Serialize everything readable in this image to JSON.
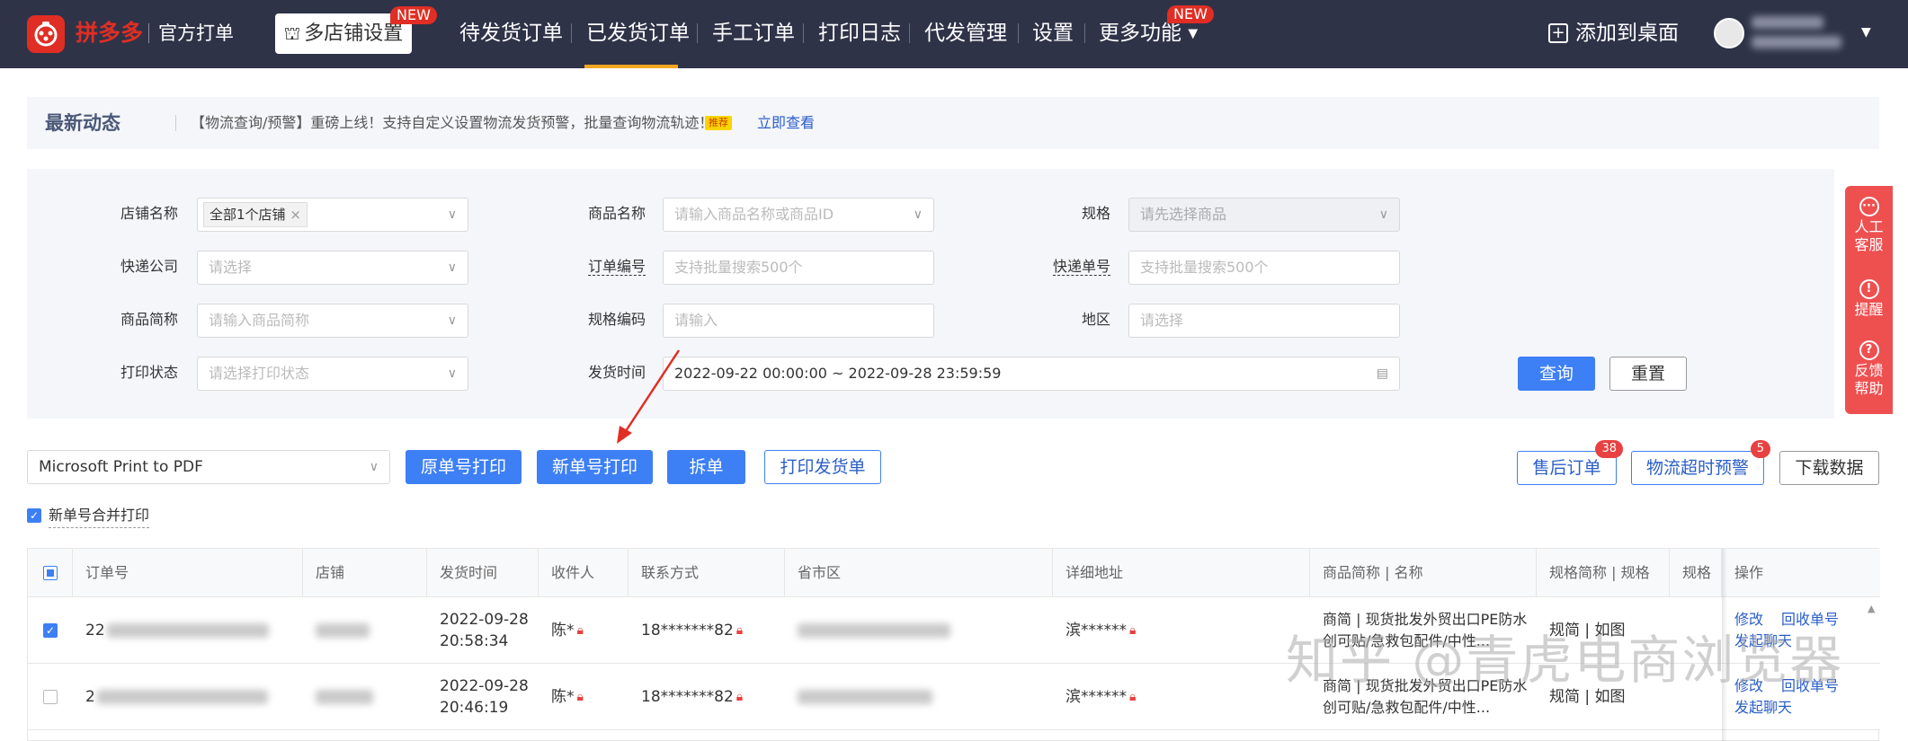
{
  "header": {
    "brand": "拼多多",
    "brand_sub": "官方打单",
    "shop_settings": "多店铺设置",
    "new_label": "NEW",
    "nav": [
      "待发货订单",
      "已发货订单",
      "手工订单",
      "打印日志",
      "代发管理",
      "设置",
      "更多功能"
    ],
    "active_tab": "已发货订单",
    "add_to_desktop": "添加到桌面"
  },
  "news": {
    "title": "最新动态",
    "text": "【物流查询/预警】重磅上线！支持自定义设置物流发货预警，批量查询物流轨迹！",
    "hot": "推荐",
    "link": "立即查看"
  },
  "filters": {
    "shop_name": {
      "label": "店铺名称",
      "value": "全部1个店铺"
    },
    "product_name": {
      "label": "商品名称",
      "placeholder": "请输入商品名称或商品ID"
    },
    "spec": {
      "label": "规格",
      "placeholder": "请先选择商品"
    },
    "courier": {
      "label": "快递公司",
      "placeholder": "请选择"
    },
    "order_no": {
      "label": "订单编号",
      "placeholder": "支持批量搜索500个"
    },
    "tracking_no": {
      "label": "快递单号",
      "placeholder": "支持批量搜索500个"
    },
    "product_short": {
      "label": "商品简称",
      "placeholder": "请输入商品简称"
    },
    "spec_code": {
      "label": "规格编码",
      "placeholder": "请输入"
    },
    "region": {
      "label": "地区",
      "placeholder": "请选择"
    },
    "print_status": {
      "label": "打印状态",
      "placeholder": "请选择打印状态"
    },
    "ship_time": {
      "label": "发货时间",
      "value": "2022-09-22 00:00:00 ~ 2022-09-28 23:59:59"
    },
    "query": "查询",
    "reset": "重置"
  },
  "side_panel": [
    {
      "icon": "···",
      "label": "人工客服"
    },
    {
      "icon": "!",
      "label": "提醒"
    },
    {
      "icon": "?",
      "label": "反馈帮助"
    }
  ],
  "toolbar": {
    "printer": "Microsoft Print to PDF",
    "orig_print": "原单号打印",
    "new_print": "新单号打印",
    "split": "拆单",
    "print_ship": "打印发货单",
    "after_sale": "售后订单",
    "after_sale_count": "38",
    "logistics_alert": "物流超时预警",
    "logistics_count": "5",
    "download": "下载数据",
    "merge_label": "新单号合并打印"
  },
  "table": {
    "columns": [
      "订单号",
      "店铺",
      "发货时间",
      "收件人",
      "联系方式",
      "省市区",
      "详细地址",
      "商品简称 | 名称",
      "规格简称 | 规格",
      "规格",
      "操作"
    ],
    "rows": [
      {
        "order_prefix": "22",
        "ship_date": "2022-09-28",
        "ship_time": "20:58:34",
        "recipient": "陈*",
        "phone": "18*******82",
        "address": "滨******",
        "product": "商简 | 现货批发外贸出口PE防水创可贴/急救包配件/中性...",
        "spec": "规简 | 如图",
        "actions": [
          "修改",
          "回收单号",
          "发起聊天"
        ],
        "checked": true
      },
      {
        "order_prefix": "2",
        "ship_date": "2022-09-28",
        "ship_time": "20:46:19",
        "recipient": "陈*",
        "phone": "18*******82",
        "address": "滨******",
        "product": "商简 | 现货批发外贸出口PE防水创可贴/急救包配件/中性...",
        "spec": "规简 | 如图",
        "actions": [
          "修改",
          "回收单号",
          "发起聊天"
        ],
        "checked": false
      }
    ]
  },
  "watermark": "知乎 @青虎电商浏览器",
  "colors": {
    "topbar": "#2f3348",
    "brand_red": "#e02e24",
    "primary": "#3d7ff5",
    "accent": "#f5a623",
    "alert_red": "#ee5050"
  }
}
